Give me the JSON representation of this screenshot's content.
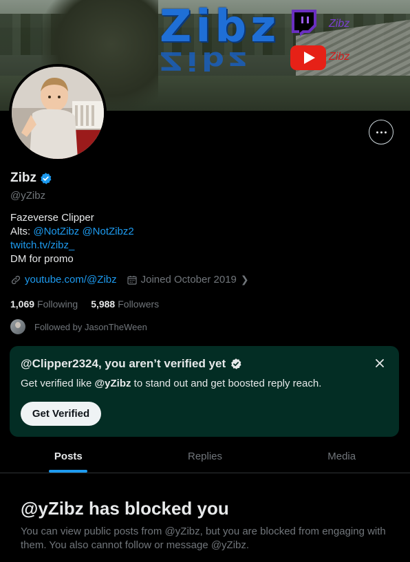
{
  "banner": {
    "logo_text": "Zibz",
    "twitch_name": "Zibz",
    "youtube_name": "Zibz"
  },
  "profile": {
    "display_name": "Zibz",
    "handle": "@yZibz",
    "verified": true,
    "bio": {
      "line1": "Fazeverse Clipper",
      "alts_label": "Alts: ",
      "alt1": "@NotZibz",
      "alt2": "@NotZibz2",
      "link": "twitch.tv/zibz_",
      "line4": "DM for promo"
    },
    "website": "youtube.com/@Zibz",
    "joined": "Joined October 2019",
    "following_count": "1,069",
    "following_label": "Following",
    "followers_count": "5,988",
    "followers_label": "Followers",
    "followed_by": "Followed by JasonTheWeen"
  },
  "verify_card": {
    "title": "@Clipper2324, you aren’t verified yet",
    "sub_prefix": "Get verified like ",
    "sub_handle": "@yZibz",
    "sub_suffix": " to stand out and get boosted reply reach.",
    "button": "Get Verified"
  },
  "tabs": [
    {
      "label": "Posts",
      "active": true
    },
    {
      "label": "Replies",
      "active": false
    },
    {
      "label": "Media",
      "active": false
    }
  ],
  "blocked": {
    "title": "@yZibz has blocked you",
    "text": "You can view public posts from @yZibz, but you are blocked from engaging with them. You also cannot follow or message @yZibz."
  },
  "colors": {
    "accent": "#1d9bf0",
    "card_bg": "#032d24",
    "twitch": "#7b3fd1",
    "youtube": "#e62117"
  }
}
